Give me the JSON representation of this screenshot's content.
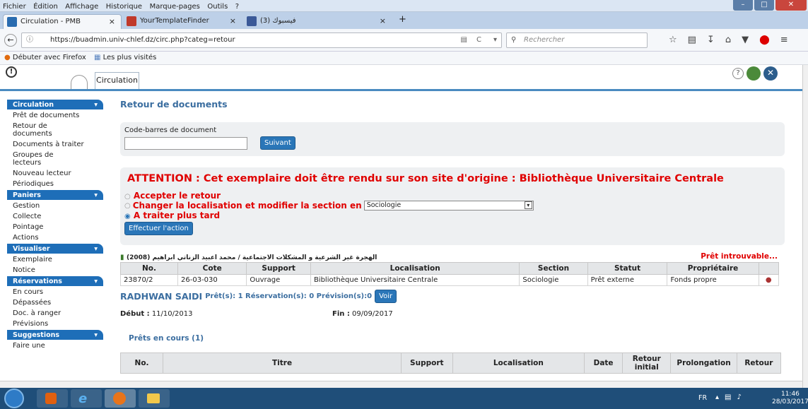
{
  "browser": {
    "menu": [
      "Fichier",
      "Édition",
      "Affichage",
      "Historique",
      "Marque-pages",
      "Outils",
      "?"
    ],
    "tabs": [
      {
        "label": "Circulation - PMB"
      },
      {
        "label": "YourTemplateFinder"
      },
      {
        "label": "فيسبوك (3)"
      }
    ],
    "url": "https://buadmin.univ-chlef.dz/circ.php?categ=retour",
    "search_placeholder": "Rechercher",
    "bookmarks": [
      "Débuter avec Firefox",
      "Les plus visités"
    ]
  },
  "header": {
    "tab_label": "Circulation"
  },
  "sidebar": {
    "sections": [
      {
        "title": "Circulation",
        "items": [
          "Prêt de documents",
          "Retour de documents",
          "Documents à traiter",
          "Groupes de lecteurs",
          "Nouveau lecteur",
          "Périodiques"
        ]
      },
      {
        "title": "Paniers",
        "items": [
          "Gestion",
          "Collecte",
          "Pointage",
          "Actions"
        ]
      },
      {
        "title": "Visualiser",
        "items": [
          "Exemplaire",
          "Notice"
        ]
      },
      {
        "title": "Réservations",
        "items": [
          "En cours",
          "Dépassées",
          "Doc. à ranger",
          "Prévisions"
        ]
      },
      {
        "title": "Suggestions",
        "items": [
          "Faire une"
        ]
      }
    ]
  },
  "main": {
    "title": "Retour de documents",
    "barcode_label": "Code-barres de document",
    "barcode_value": "",
    "next_button": "Suivant",
    "attention": "ATTENTION : Cet exemplaire doit être rendu sur son site d'origine : Bibliothèque Universitaire Centrale",
    "options": {
      "accept": "Accepter le retour",
      "change": "Changer la localisation et modifier la section en",
      "later": "A traiter plus tard",
      "selected": "later"
    },
    "section_select": "Sociologie",
    "action_button": "Effectuer l'action",
    "doc_title": "الهجرة غير الشرعية و المشكلات الاجتماعية / محمد اعبيد الزناتي ابراهيم (2008)",
    "pret_status": "Prêt introuvable...",
    "copy_table": {
      "headers": [
        "No.",
        "Cote",
        "Support",
        "Localisation",
        "Section",
        "Statut",
        "Propriétaire",
        ""
      ],
      "rows": [
        [
          "23870/2",
          "26-03-030",
          "Ouvrage",
          "Bibliothèque Universitaire Centrale",
          "Sociologie",
          "Prêt externe",
          "Fonds propre"
        ]
      ]
    },
    "reader": {
      "name": "RADHWAN SAIDI",
      "stats": "Prêt(s): 1 Réservation(s): 0 Prévision(s):0",
      "voir": "Voir"
    },
    "debut_label": "Début :",
    "debut_value": "11/10/2013",
    "fin_label": "Fin :",
    "fin_value": "09/09/2017",
    "loans_title": "Prêts en cours (1)",
    "loans_headers": [
      "No.",
      "Titre",
      "Support",
      "Localisation",
      "Date",
      "Retour initial",
      "Prolongation",
      "Retour"
    ]
  },
  "taskbar": {
    "lang": "FR",
    "time": "11:46",
    "date": "28/03/2017"
  }
}
